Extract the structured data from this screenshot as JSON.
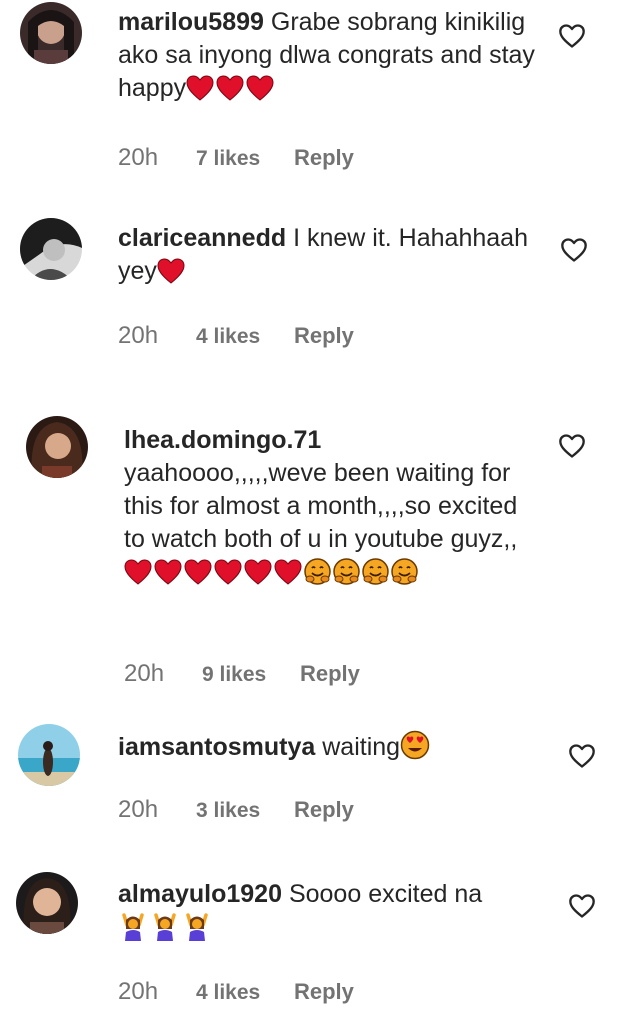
{
  "comments": [
    {
      "username": "marilou5899",
      "text": "Grabe sobrang kinikilig ako sa inyong dlwa congrats and stay happy",
      "emojis": [
        "red-heart",
        "red-heart",
        "red-heart"
      ],
      "time": "20h",
      "likes": "7 likes",
      "reply": "Reply"
    },
    {
      "username": "clariceannedd",
      "text": "I knew it. Hahahhaah yey",
      "emojis": [
        "red-heart"
      ],
      "time": "20h",
      "likes": "4 likes",
      "reply": "Reply"
    },
    {
      "username": "lhea.domingo.71",
      "text": "yaahoooo,,,,,weve been waiting for this for almost a month,,,,so excited to watch both of u in youtube guyz,,",
      "emojis": [
        "red-heart",
        "red-heart",
        "red-heart",
        "red-heart",
        "red-heart",
        "red-heart",
        "hugging-face",
        "hugging-face",
        "hugging-face",
        "hugging-face"
      ],
      "time": "20h",
      "likes": "9 likes",
      "reply": "Reply"
    },
    {
      "username": "iamsantosmutya",
      "text": "waiting",
      "emojis": [
        "heart-eyes-face"
      ],
      "time": "20h",
      "likes": "3 likes",
      "reply": "Reply"
    },
    {
      "username": "almayulo1920",
      "text": "Soooo excited na",
      "emojis": [
        "raising-hands-woman",
        "raising-hands-woman",
        "raising-hands-woman"
      ],
      "time": "20h",
      "likes": "4 likes",
      "reply": "Reply"
    }
  ],
  "colors": {
    "text": "#262626",
    "meta": "#737373",
    "heart_red": "#e0102a"
  },
  "icons": {
    "like": "heart-outline-icon"
  }
}
